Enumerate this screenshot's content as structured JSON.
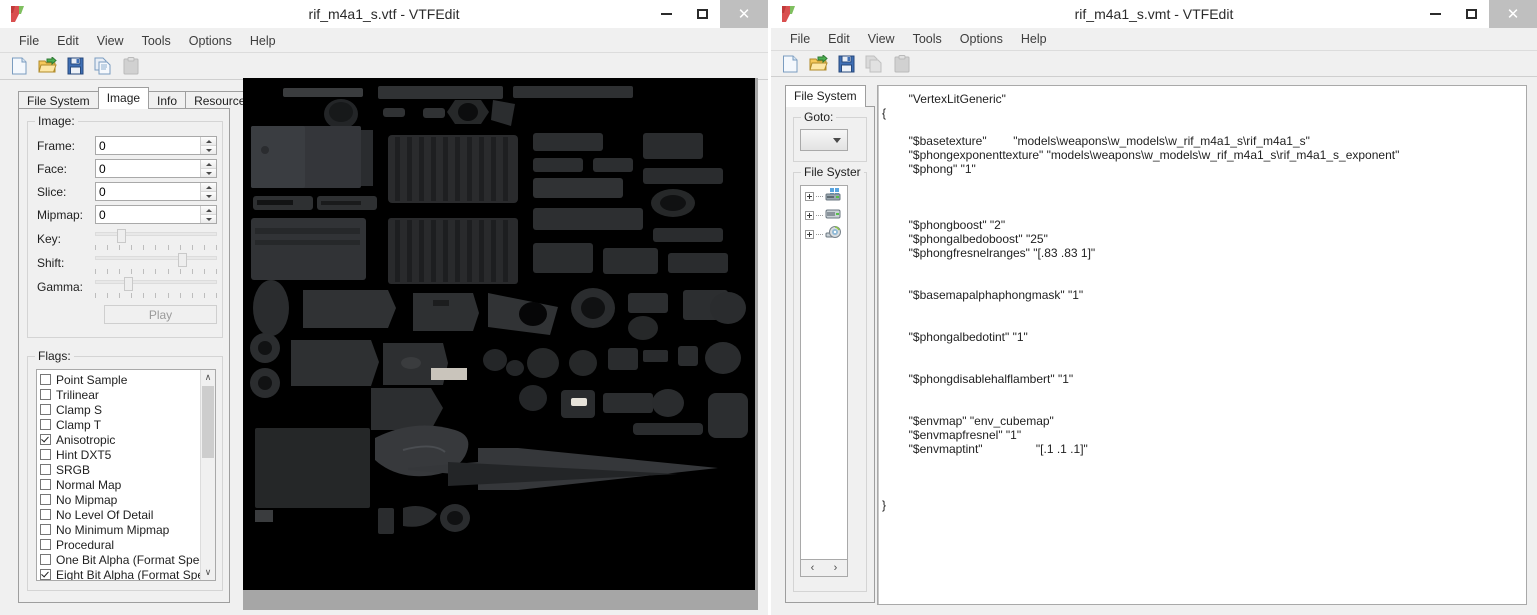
{
  "left_window": {
    "title": "rif_m4a1_s.vtf - VTFEdit",
    "app_icon": "vtfedit-icon",
    "window_buttons": {
      "minimize": "—",
      "maximize": "☐",
      "close": "✕"
    },
    "menu": [
      "File",
      "Edit",
      "View",
      "Tools",
      "Options",
      "Help"
    ],
    "toolbar": [
      {
        "name": "new-file-icon",
        "label": "New"
      },
      {
        "name": "open-folder-icon",
        "label": "Open"
      },
      {
        "name": "save-icon",
        "label": "Save"
      },
      {
        "name": "copy-icon",
        "label": "Copy"
      },
      {
        "name": "paste-icon",
        "label": "Paste"
      }
    ],
    "tabs": [
      {
        "label": "File System",
        "active": false
      },
      {
        "label": "Image",
        "active": true
      },
      {
        "label": "Info",
        "active": false
      },
      {
        "label": "Resources",
        "active": false
      }
    ],
    "image_group": {
      "legend": "Image:",
      "fields": [
        {
          "label": "Frame:",
          "value": "0"
        },
        {
          "label": "Face:",
          "value": "0"
        },
        {
          "label": "Slice:",
          "value": "0"
        },
        {
          "label": "Mipmap:",
          "value": "0"
        }
      ],
      "sliders": [
        {
          "label": "Key:",
          "percent": 18
        },
        {
          "label": "Shift:",
          "percent": 70
        },
        {
          "label": "Gamma:",
          "percent": 26
        }
      ],
      "play_button": "Play"
    },
    "flags_group": {
      "legend": "Flags:",
      "items": [
        {
          "label": "Point Sample",
          "checked": false
        },
        {
          "label": "Trilinear",
          "checked": false
        },
        {
          "label": "Clamp S",
          "checked": false
        },
        {
          "label": "Clamp T",
          "checked": false
        },
        {
          "label": "Anisotropic",
          "checked": true
        },
        {
          "label": "Hint DXT5",
          "checked": false
        },
        {
          "label": "SRGB",
          "checked": false
        },
        {
          "label": "Normal Map",
          "checked": false
        },
        {
          "label": "No Mipmap",
          "checked": false
        },
        {
          "label": "No Level Of Detail",
          "checked": false
        },
        {
          "label": "No Minimum Mipmap",
          "checked": false
        },
        {
          "label": "Procedural",
          "checked": false
        },
        {
          "label": "One Bit Alpha (Format Spec",
          "checked": false
        },
        {
          "label": "Eight Bit Alpha (Format Spe",
          "checked": true
        }
      ],
      "scroll_up": "∧",
      "scroll_down": "∨"
    },
    "preview": {
      "name": "texture-preview",
      "background_color": "#000000"
    }
  },
  "right_window": {
    "title": "rif_m4a1_s.vmt - VTFEdit",
    "app_icon": "vtfedit-icon",
    "window_buttons": {
      "minimize": "—",
      "maximize": "☐",
      "close": "✕"
    },
    "menu": [
      "File",
      "Edit",
      "View",
      "Tools",
      "Options",
      "Help"
    ],
    "toolbar": [
      {
        "name": "new-file-icon",
        "label": "New"
      },
      {
        "name": "open-folder-icon",
        "label": "Open"
      },
      {
        "name": "save-icon",
        "label": "Save"
      },
      {
        "name": "copy-icon",
        "label": "Copy"
      },
      {
        "name": "paste-icon",
        "label": "Paste"
      }
    ],
    "tabs": [
      {
        "label": "File System",
        "active": true
      }
    ],
    "goto_group": {
      "legend": "Goto:",
      "selected": ""
    },
    "filesystem_group": {
      "legend": "File Syster",
      "nodes": [
        {
          "icon": "windows-drive-icon"
        },
        {
          "icon": "local-disk-icon"
        },
        {
          "icon": "cd-drive-icon"
        }
      ],
      "scroll_left": "‹",
      "scroll_right": "›"
    },
    "editor": {
      "text": "        \"VertexLitGeneric\"\n{\n\n        \"$basetexture\"        \"models\\weapons\\w_models\\w_rif_m4a1_s\\rif_m4a1_s\"\n        \"$phongexponenttexture\" \"models\\weapons\\w_models\\w_rif_m4a1_s\\rif_m4a1_s_exponent\"\n        \"$phong\" \"1\"\n\n\n\n        \"$phongboost\" \"2\"\n        \"$phongalbedoboost\" \"25\"\n        \"$phongfresnelranges\" \"[.83 .83 1]\"\n\n\n        \"$basemapalphaphongmask\" \"1\"\n\n\n        \"$phongalbedotint\" \"1\"\n\n\n        \"$phongdisablehalflambert\" \"1\"\n\n\n        \"$envmap\" \"env_cubemap\"\n        \"$envmapfresnel\" \"1\"\n        \"$envmaptint\"                \"[.1 .1 .1]\"\n\n\n\n}"
    }
  }
}
